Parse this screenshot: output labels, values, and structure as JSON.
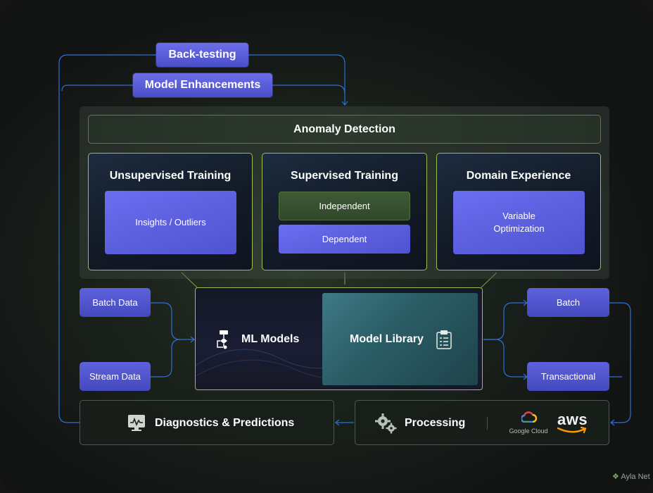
{
  "top_pills": {
    "backtesting": "Back-testing",
    "model_enhancements": "Model Enhancements"
  },
  "anomaly_detection": "Anomaly Detection",
  "cards": {
    "unsupervised": {
      "title": "Unsupervised Training",
      "item": "Insights / Outliers"
    },
    "supervised": {
      "title": "Supervised Training",
      "item_1": "Independent",
      "item_2": "Dependent"
    },
    "domain": {
      "title": "Domain Experience",
      "item_line1": "Variable",
      "item_line2": "Optimization"
    }
  },
  "inputs": {
    "batch_data": "Batch Data",
    "stream_data": "Stream Data"
  },
  "outputs": {
    "batch": "Batch",
    "transactional": "Transactional"
  },
  "center": {
    "ml_models": "ML Models",
    "model_library": "Model Library"
  },
  "bottom": {
    "diagnostics": "Diagnostics & Predictions",
    "processing": "Processing",
    "google_cloud": "Google Cloud",
    "aws": "aws"
  },
  "watermark": "Ayla Net",
  "icons": {
    "ml_models": "flowchart-icon",
    "model_library": "clipboard-icon",
    "diagnostics": "monitor-chart-icon",
    "processing": "gears-icon",
    "google_cloud": "google-cloud-logo",
    "aws": "aws-logo",
    "watermark": "leaf-icon"
  },
  "colors": {
    "connector_line": "#2d6fd6",
    "card_border": "#9bbd52",
    "anomaly_border": "#a25a2f",
    "pill_purple": "#5d62dc",
    "pill_green": "#3e5a35"
  }
}
